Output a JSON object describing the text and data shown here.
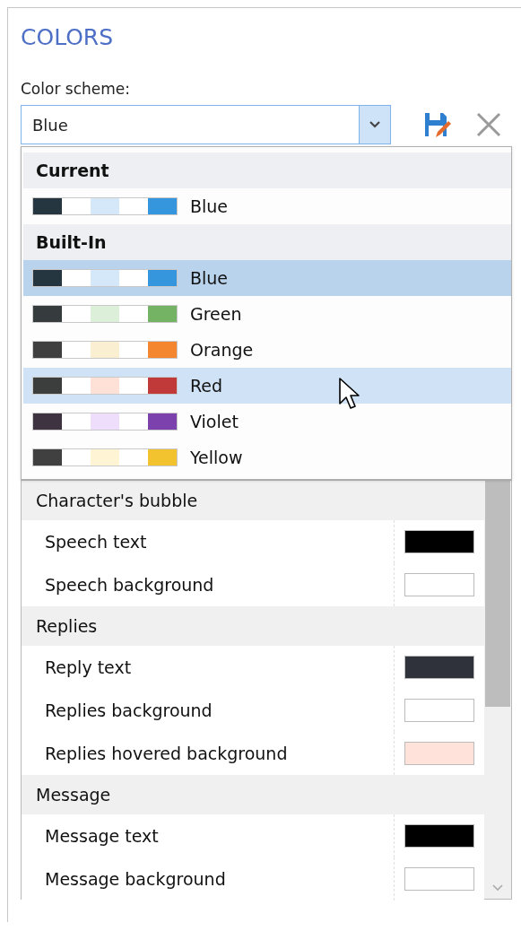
{
  "title": "COLORS",
  "scheme_label": "Color scheme:",
  "scheme_field": {
    "value": "Blue"
  },
  "dropdown": {
    "groups": [
      {
        "heading": "Current",
        "items": [
          {
            "name": "Blue",
            "swatches": [
              {
                "color": "#263641"
              },
              {
                "color": "#d4e8fa"
              },
              {
                "color": "#3596de"
              }
            ],
            "selected": false,
            "hovered": false
          }
        ]
      },
      {
        "heading": "Built-In",
        "items": [
          {
            "name": "Blue",
            "swatches": [
              {
                "color": "#263641"
              },
              {
                "color": "#d4e8fa"
              },
              {
                "color": "#3596de"
              }
            ],
            "selected": true,
            "hovered": false
          },
          {
            "name": "Green",
            "swatches": [
              {
                "color": "#363c3e"
              },
              {
                "color": "#dcf0d9"
              },
              {
                "color": "#73b363"
              }
            ],
            "selected": false,
            "hovered": false
          },
          {
            "name": "Orange",
            "swatches": [
              {
                "color": "#3f3f3f"
              },
              {
                "color": "#faf0d1"
              },
              {
                "color": "#f3862f"
              }
            ],
            "selected": false,
            "hovered": false
          },
          {
            "name": "Red",
            "swatches": [
              {
                "color": "#3c3d3d"
              },
              {
                "color": "#ffe1d8"
              },
              {
                "color": "#c13a3a"
              }
            ],
            "selected": false,
            "hovered": true
          },
          {
            "name": "Violet",
            "swatches": [
              {
                "color": "#3e3341"
              },
              {
                "color": "#eedefb"
              },
              {
                "color": "#7d41ad"
              }
            ],
            "selected": false,
            "hovered": false
          },
          {
            "name": "Yellow",
            "swatches": [
              {
                "color": "#404040"
              },
              {
                "color": "#fff4d4"
              },
              {
                "color": "#f2c32f"
              }
            ],
            "selected": false,
            "hovered": false
          }
        ]
      }
    ]
  },
  "settings": [
    {
      "heading": "Character's bubble",
      "items": [
        {
          "label": "Speech text",
          "color": "#000000"
        },
        {
          "label": "Speech background",
          "color": "#ffffff"
        }
      ]
    },
    {
      "heading": "Replies",
      "items": [
        {
          "label": "Reply text",
          "color": "#2f323b"
        },
        {
          "label": "Replies background",
          "color": "#ffffff"
        },
        {
          "label": "Replies hovered background",
          "color": "#ffe3da"
        }
      ]
    },
    {
      "heading": "Message",
      "items": [
        {
          "label": "Message text",
          "color": "#000000"
        },
        {
          "label": "Message background",
          "color": "#ffffff"
        }
      ]
    }
  ]
}
